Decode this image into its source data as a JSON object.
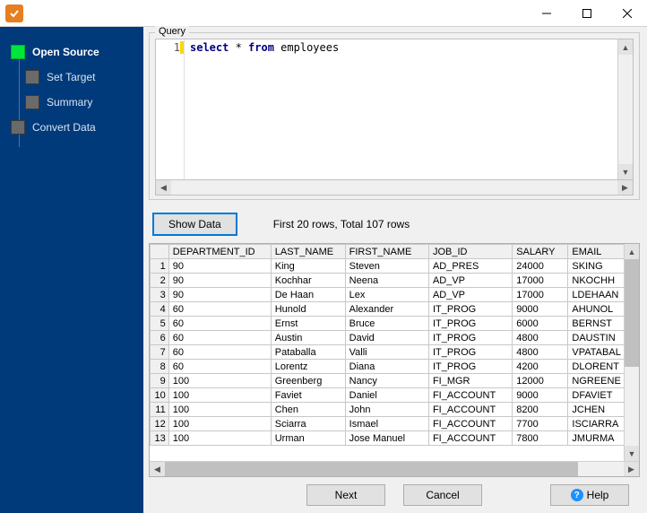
{
  "titlebar": {
    "app_glyph": "⎘"
  },
  "sidebar": {
    "items": [
      {
        "label": "Open Source",
        "active": true,
        "child": false
      },
      {
        "label": "Set Target",
        "active": false,
        "child": true
      },
      {
        "label": "Summary",
        "active": false,
        "child": true
      },
      {
        "label": "Convert Data",
        "active": false,
        "child": false
      }
    ]
  },
  "query": {
    "legend": "Query",
    "line_number": "1",
    "code_kw1": "select",
    "code_star": " * ",
    "code_kw2": "from",
    "code_rest": " employees"
  },
  "controls": {
    "show_data_label": "Show Data",
    "status_text": "First 20 rows, Total 107 rows"
  },
  "table": {
    "headers": [
      "DEPARTMENT_ID",
      "LAST_NAME",
      "FIRST_NAME",
      "JOB_ID",
      "SALARY",
      "EMAIL"
    ],
    "rows": [
      [
        "90",
        "King",
        "Steven",
        "AD_PRES",
        "24000",
        "SKING"
      ],
      [
        "90",
        "Kochhar",
        "Neena",
        "AD_VP",
        "17000",
        "NKOCHH"
      ],
      [
        "90",
        "De Haan",
        "Lex",
        "AD_VP",
        "17000",
        "LDEHAAN"
      ],
      [
        "60",
        "Hunold",
        "Alexander",
        "IT_PROG",
        "9000",
        "AHUNOL"
      ],
      [
        "60",
        "Ernst",
        "Bruce",
        "IT_PROG",
        "6000",
        "BERNST"
      ],
      [
        "60",
        "Austin",
        "David",
        "IT_PROG",
        "4800",
        "DAUSTIN"
      ],
      [
        "60",
        "Pataballa",
        "Valli",
        "IT_PROG",
        "4800",
        "VPATABAL"
      ],
      [
        "60",
        "Lorentz",
        "Diana",
        "IT_PROG",
        "4200",
        "DLORENT"
      ],
      [
        "100",
        "Greenberg",
        "Nancy",
        "FI_MGR",
        "12000",
        "NGREENE"
      ],
      [
        "100",
        "Faviet",
        "Daniel",
        "FI_ACCOUNT",
        "9000",
        "DFAVIET"
      ],
      [
        "100",
        "Chen",
        "John",
        "FI_ACCOUNT",
        "8200",
        "JCHEN"
      ],
      [
        "100",
        "Sciarra",
        "Ismael",
        "FI_ACCOUNT",
        "7700",
        "ISCIARRA"
      ],
      [
        "100",
        "Urman",
        "Jose Manuel",
        "FI_ACCOUNT",
        "7800",
        "JMURMA"
      ]
    ]
  },
  "buttons": {
    "next": "Next",
    "cancel": "Cancel",
    "help": "Help"
  }
}
